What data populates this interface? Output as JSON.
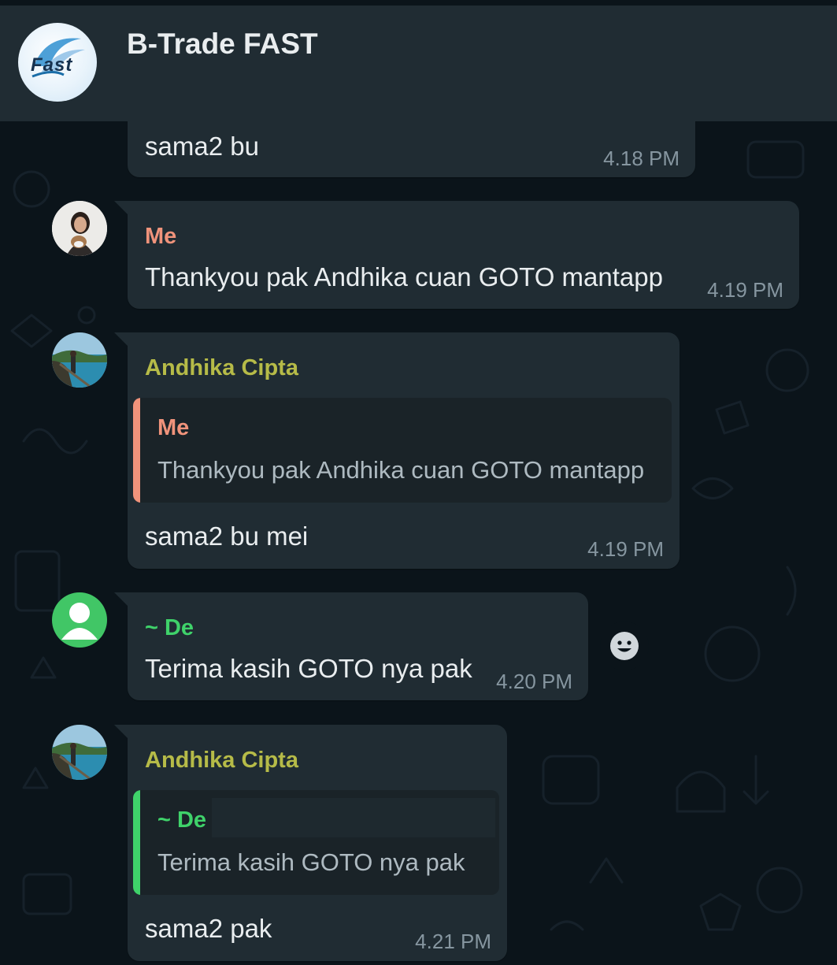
{
  "header": {
    "group_name": "B-Trade FAST",
    "logo_text": "Fast"
  },
  "messages": [
    {
      "text": "sama2 bu",
      "time": "4.18 PM"
    },
    {
      "sender": "Me",
      "text": "Thankyou pak Andhika cuan GOTO mantapp",
      "time": "4.19 PM"
    },
    {
      "sender": "Andhika Cipta",
      "quote": {
        "sender": "Me",
        "text": "Thankyou pak Andhika cuan GOTO mantapp"
      },
      "text": "sama2 bu mei",
      "time": "4.19 PM"
    },
    {
      "sender": "~ De",
      "text": "Terima kasih GOTO nya pak",
      "time": "4.20 PM"
    },
    {
      "sender": "Andhika Cipta",
      "quote": {
        "sender": "~ De",
        "text": "Terima kasih GOTO nya pak"
      },
      "text": "sama2 pak",
      "time": "4.21 PM"
    }
  ],
  "colors": {
    "me": "#f0937b",
    "andhika": "#b6bb48",
    "de": "#3fd26a",
    "bubble": "#202c33",
    "background": "#0b141a",
    "time": "#8696a0"
  },
  "icons": [
    "emoji-icon",
    "default-user-icon"
  ]
}
